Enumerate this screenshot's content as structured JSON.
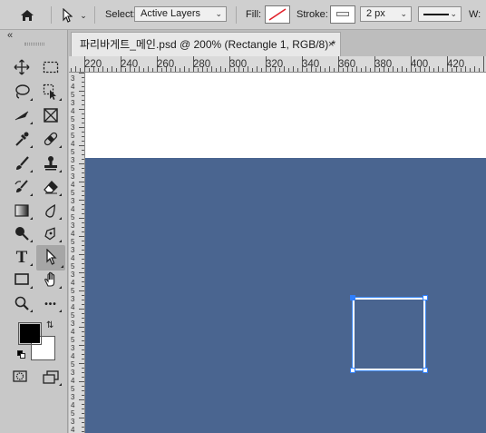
{
  "options_bar": {
    "home_icon": "home-icon",
    "tool_icon": "direct-selection-arrow-icon",
    "select_label": "Select:",
    "select_value": "Active Layers",
    "fill_label": "Fill:",
    "stroke_label": "Stroke:",
    "stroke_width": "2 px",
    "w_label": "W:"
  },
  "toolbox": {
    "collapse_glyph": "«",
    "tools": [
      {
        "name": "move-tool",
        "icon": "move-icon"
      },
      {
        "name": "rectangular-marquee-tool",
        "icon": "marquee-icon"
      },
      {
        "name": "lasso-tool",
        "icon": "lasso-icon"
      },
      {
        "name": "object-selection-tool",
        "icon": "object-selection-icon"
      },
      {
        "name": "slice-tool",
        "icon": "slice-icon"
      },
      {
        "name": "frame-tool",
        "icon": "frame-icon"
      },
      {
        "name": "eyedropper-tool",
        "icon": "eyedropper-icon"
      },
      {
        "name": "healing-brush-tool",
        "icon": "bandage-icon"
      },
      {
        "name": "brush-tool",
        "icon": "brush-icon"
      },
      {
        "name": "clone-stamp-tool",
        "icon": "stamp-icon"
      },
      {
        "name": "history-brush-tool",
        "icon": "history-brush-icon"
      },
      {
        "name": "eraser-tool",
        "icon": "eraser-icon"
      },
      {
        "name": "gradient-tool",
        "icon": "gradient-icon"
      },
      {
        "name": "blur-tool",
        "icon": "drop-icon"
      },
      {
        "name": "dodge-tool",
        "icon": "dodge-icon"
      },
      {
        "name": "pen-tool",
        "icon": "pen-icon"
      },
      {
        "name": "type-tool",
        "icon": "type-icon"
      },
      {
        "name": "direct-selection-tool",
        "icon": "arrow-icon",
        "active": true
      },
      {
        "name": "rectangle-tool",
        "icon": "rectangle-icon"
      },
      {
        "name": "hand-tool",
        "icon": "hand-icon"
      },
      {
        "name": "zoom-tool",
        "icon": "zoom-icon"
      },
      {
        "name": "edit-toolbar",
        "icon": "more-icon"
      }
    ],
    "type_glyph": "T",
    "more_glyph": "•••",
    "foreground_color": "#000000",
    "background_color": "#ffffff"
  },
  "document": {
    "tab_title": "파리바게트_메인.psd @ 200% (Rectangle 1, RGB/8) *",
    "close_glyph": "×",
    "ruler_labels": [
      "220",
      "240",
      "260",
      "280",
      "300",
      "320",
      "340",
      "360",
      "380",
      "400",
      "420"
    ],
    "vruler_labels": [
      "3",
      "4",
      "5",
      "3",
      "4",
      "5",
      "3",
      "5",
      "4",
      "5",
      "3",
      "5",
      "3",
      "4",
      "5",
      "3",
      "4",
      "5",
      "3",
      "4",
      "5",
      "3",
      "4",
      "5",
      "3",
      "4",
      "5",
      "3",
      "4",
      "5",
      "3",
      "4",
      "5",
      "3",
      "4",
      "5",
      "3",
      "4",
      "5",
      "3",
      "4",
      "5",
      "3",
      "4",
      "5"
    ],
    "canvas_color": "#4a6590",
    "shape_stroke_color": "#ffffff"
  }
}
